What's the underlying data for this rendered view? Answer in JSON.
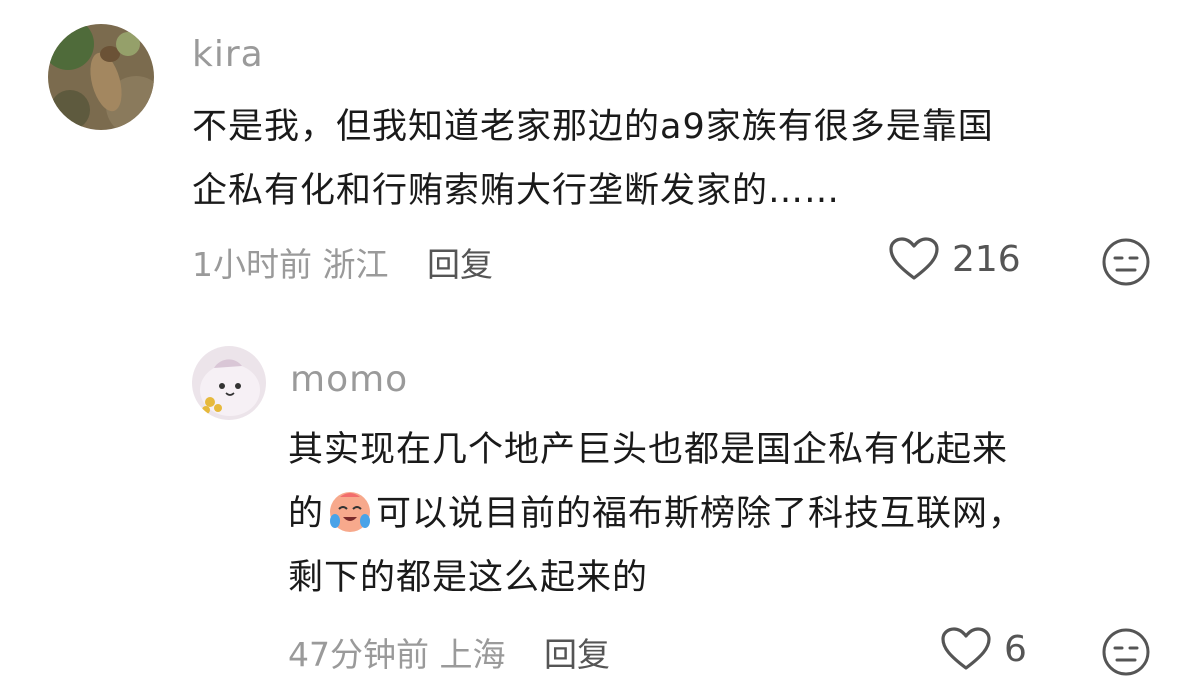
{
  "comments": [
    {
      "username": "kira",
      "text_lines": [
        "不是我，但我知道老家那边的a9家族有很多是靠国",
        "企私有化和行贿索贿大行垄断发家的……"
      ],
      "time": "1小时前",
      "location": "浙江",
      "reply_label": "回复",
      "like_count": "216",
      "like_icon": "heart-outline-icon",
      "dislike_icon": "meh-face-icon"
    },
    {
      "username": "momo",
      "text_lines": [
        "其实现在几个地产巨头也都是国企私有化起来",
        "可以说目前的福布斯榜除了科技互联网，",
        "剩下的都是这么起来的"
      ],
      "text_line2_prefix": "的",
      "inline_emoji": "crying-laughing-emoji",
      "time": "47分钟前",
      "location": "上海",
      "reply_label": "回复",
      "like_count": "6",
      "like_icon": "heart-outline-icon",
      "dislike_icon": "meh-face-icon"
    }
  ],
  "colors": {
    "meta_gray": "#9a9a9a",
    "text_dark": "#1a1a1a"
  }
}
